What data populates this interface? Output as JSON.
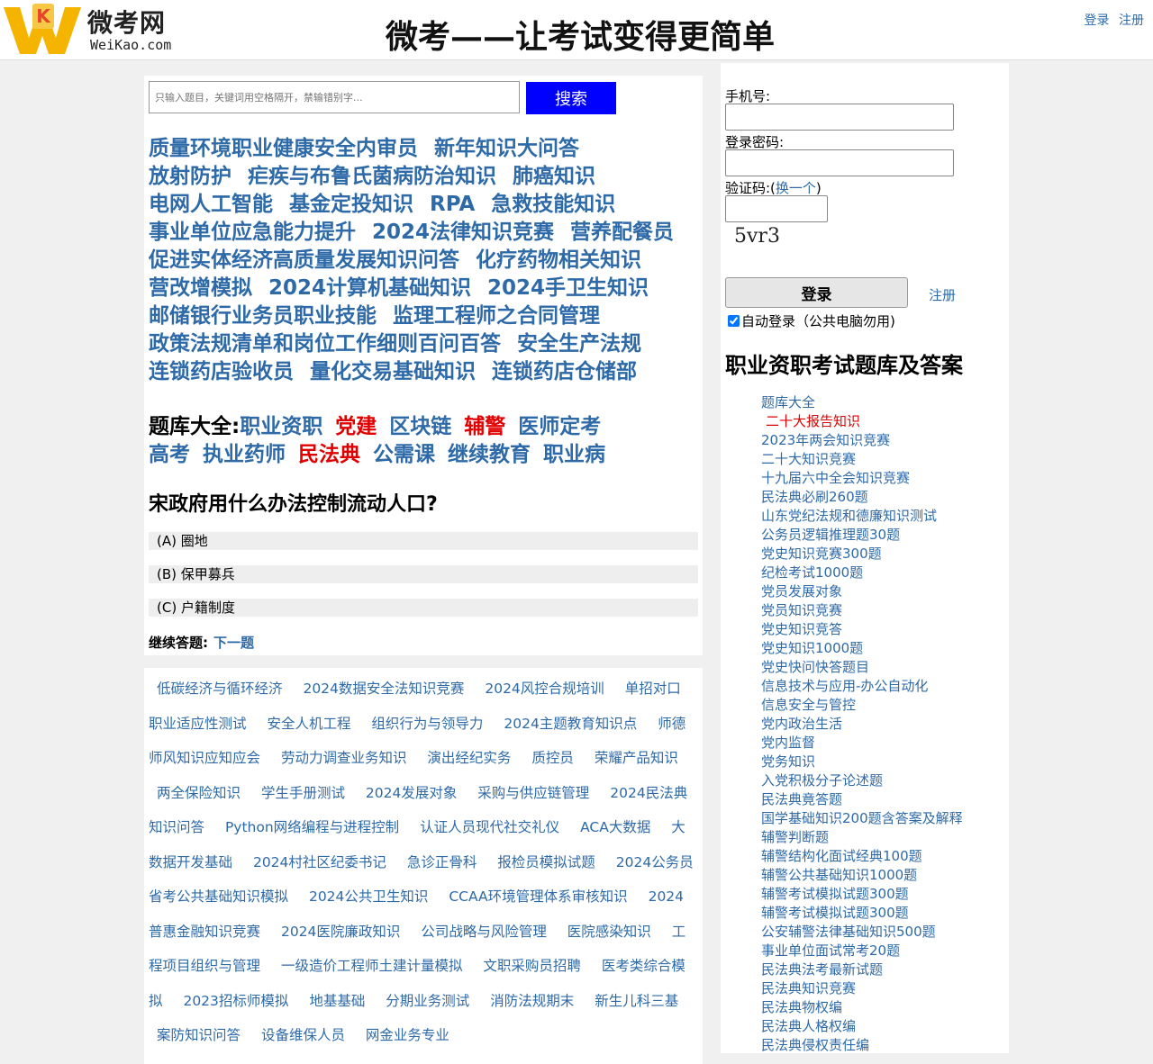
{
  "brand": {
    "name_cn": "微考网",
    "name_en": "WeiKao.com",
    "logo_letter": "K",
    "slogan": "微考——让考试变得更简单"
  },
  "top_nav": {
    "login": "登录",
    "register": "注册"
  },
  "search": {
    "placeholder": "只输入题目，关键词用空格隔开，禁输错别字...",
    "button": "搜索"
  },
  "topics": [
    "质量环境职业健康安全内审员",
    "新年知识大问答",
    "放射防护",
    "疟疾与布鲁氏菌病防治知识",
    "肺癌知识",
    "电网人工智能",
    "基金定投知识",
    "RPA",
    "急救技能知识",
    "事业单位应急能力提升",
    "2024法律知识竞赛",
    "营养配餐员",
    "促进实体经济高质量发展知识问答",
    "化疗药物相关知识",
    "营改增模拟",
    "2024计算机基础知识",
    "2024手卫生知识",
    "邮储银行业务员职业技能",
    "监理工程师之合同管理",
    "政策法规清单和岗位工作细则百问百答",
    "安全生产法规",
    "连锁药店验收员",
    "量化交易基础知识",
    "连锁药店仓储部"
  ],
  "categories": {
    "label": "题库大全:",
    "items": [
      {
        "text": "职业资职",
        "hot": false
      },
      {
        "text": "党建",
        "hot": true
      },
      {
        "text": "区块链",
        "hot": false
      },
      {
        "text": "辅警",
        "hot": true
      },
      {
        "text": "医师定考",
        "hot": false
      },
      {
        "text": "高考",
        "hot": false
      },
      {
        "text": "执业药师",
        "hot": false
      },
      {
        "text": "民法典",
        "hot": true
      },
      {
        "text": "公需课",
        "hot": false
      },
      {
        "text": "继续教育",
        "hot": false
      },
      {
        "text": "职业病",
        "hot": false
      }
    ]
  },
  "question": {
    "text": "宋政府用什么办法控制流动人口?",
    "options": [
      "(A)  圈地",
      "(B)  保甲募兵",
      "(C)  户籍制度"
    ],
    "continue_label": "继续答题:",
    "next": "下一题"
  },
  "related_links": [
    "低碳经济与循环经济",
    "2024数据安全法知识竞赛",
    "2024风控合规培训",
    "单招对口职业适应性测试",
    "安全人机工程",
    "组织行为与领导力",
    "2024主题教育知识点",
    "师德师风知识应知应会",
    "劳动力调查业务知识",
    "演出经纪实务",
    "质控员",
    "荣耀产品知识",
    "两全保险知识",
    "学生手册测试",
    "2024发展对象",
    "采购与供应链管理",
    "2024民法典知识问答",
    "Python网络编程与进程控制",
    "认证人员现代社交礼仪",
    "ACA大数据",
    "大数据开发基础",
    "2024村社区纪委书记",
    "急诊正骨科",
    "报检员模拟试题",
    "2024公务员省考公共基础知识模拟",
    "2024公共卫生知识",
    "CCAA环境管理体系审核知识",
    "2024普惠金融知识竞赛",
    "2024医院廉政知识",
    "公司战略与风险管理",
    "医院感染知识",
    "工程项目组织与管理",
    "一级造价工程师土建计量模拟",
    "文职采购员招聘",
    "医考类综合模拟",
    "2023招标师模拟",
    "地基基础",
    "分期业务测试",
    "消防法规期末",
    "新生儿科三基",
    "案防知识问答",
    "设备维保人员",
    "网金业务专业"
  ],
  "login": {
    "phone_label": "手机号:",
    "password_label": "登录密码:",
    "captcha_label": "验证码:(",
    "captcha_change": "换一个",
    "captcha_close": ")",
    "captcha_text": "5vr3",
    "login_button": "登录",
    "register": "注册",
    "auto_login": "自动登录（公共电脑勿用)"
  },
  "sidebar": {
    "title": "职业资职考试题库及答案",
    "exams": [
      {
        "text": "题库大全",
        "hot": false
      },
      {
        "text": "二十大报告知识",
        "hot": true
      },
      {
        "text": "2023年两会知识竞赛",
        "hot": false
      },
      {
        "text": "二十大知识竞赛",
        "hot": false
      },
      {
        "text": "十九届六中全会知识竞赛",
        "hot": false
      },
      {
        "text": "民法典必刷260题",
        "hot": false
      },
      {
        "text": "山东党纪法规和德廉知识测试",
        "hot": false
      },
      {
        "text": "公务员逻辑推理题30题",
        "hot": false
      },
      {
        "text": "党史知识竞赛300题",
        "hot": false
      },
      {
        "text": "纪检考试1000题",
        "hot": false
      },
      {
        "text": "党员发展对象",
        "hot": false
      },
      {
        "text": "党员知识竞赛",
        "hot": false
      },
      {
        "text": "党史知识竞答",
        "hot": false
      },
      {
        "text": "党史知识1000题",
        "hot": false
      },
      {
        "text": "党史快问快答题目",
        "hot": false
      },
      {
        "text": "信息技术与应用-办公自动化",
        "hot": false
      },
      {
        "text": "信息安全与管控",
        "hot": false
      },
      {
        "text": "党内政治生活",
        "hot": false
      },
      {
        "text": "党内监督",
        "hot": false
      },
      {
        "text": "党务知识",
        "hot": false
      },
      {
        "text": "入党积极分子论述题",
        "hot": false
      },
      {
        "text": "民法典竟答题",
        "hot": false
      },
      {
        "text": "国学基础知识200题含答案及解释",
        "hot": false
      },
      {
        "text": "辅警判断题",
        "hot": false
      },
      {
        "text": "辅警结构化面试经典100题",
        "hot": false
      },
      {
        "text": "辅警公共基础知识1000题",
        "hot": false
      },
      {
        "text": "辅警考试模拟试题300题",
        "hot": false
      },
      {
        "text": "辅警考试模拟试题300题",
        "hot": false
      },
      {
        "text": "公安辅警法律基础知识500题",
        "hot": false
      },
      {
        "text": "事业单位面试常考20题",
        "hot": false
      },
      {
        "text": "民法典法考最新试题",
        "hot": false
      },
      {
        "text": "民法典知识竞赛",
        "hot": false
      },
      {
        "text": "民法典物权编",
        "hot": false
      },
      {
        "text": "民法典人格权编",
        "hot": false
      },
      {
        "text": "民法典侵权责任编",
        "hot": false
      }
    ]
  }
}
